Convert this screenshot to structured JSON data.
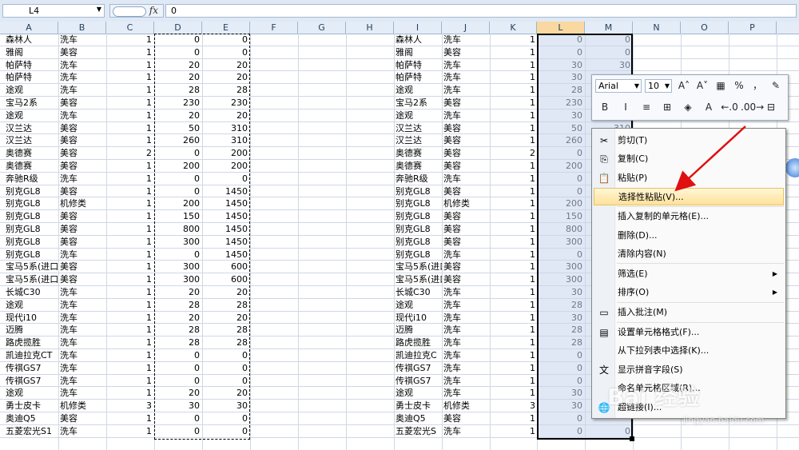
{
  "formula_bar": {
    "name_box": "L4",
    "value": "0"
  },
  "columns": [
    {
      "label": "A",
      "sel": false
    },
    {
      "label": "B",
      "sel": false
    },
    {
      "label": "C",
      "sel": false
    },
    {
      "label": "D",
      "sel": false
    },
    {
      "label": "E",
      "sel": false
    },
    {
      "label": "F",
      "sel": false
    },
    {
      "label": "G",
      "sel": false
    },
    {
      "label": "H",
      "sel": false
    },
    {
      "label": "I",
      "sel": false
    },
    {
      "label": "J",
      "sel": false
    },
    {
      "label": "K",
      "sel": false
    },
    {
      "label": "L",
      "sel": true
    },
    {
      "label": "M",
      "sel": false
    },
    {
      "label": "N",
      "sel": false
    },
    {
      "label": "O",
      "sel": false
    },
    {
      "label": "P",
      "sel": false
    }
  ],
  "left_rows": [
    [
      "森林人",
      "洗车",
      "1",
      "0",
      "0"
    ],
    [
      "雅阁",
      "美容",
      "1",
      "0",
      "0"
    ],
    [
      "帕萨特",
      "洗车",
      "1",
      "20",
      "20"
    ],
    [
      "帕萨特",
      "洗车",
      "1",
      "20",
      "20"
    ],
    [
      "途观",
      "洗车",
      "1",
      "28",
      "28"
    ],
    [
      "宝马2系",
      "美容",
      "1",
      "230",
      "230"
    ],
    [
      "途观",
      "洗车",
      "1",
      "20",
      "20"
    ],
    [
      "汉兰达",
      "美容",
      "1",
      "50",
      "310"
    ],
    [
      "汉兰达",
      "美容",
      "1",
      "260",
      "310"
    ],
    [
      "奥德赛",
      "美容",
      "2",
      "0",
      "200"
    ],
    [
      "奥德赛",
      "美容",
      "1",
      "200",
      "200"
    ],
    [
      "奔驰R级",
      "洗车",
      "1",
      "0",
      "0"
    ],
    [
      "别克GL8",
      "美容",
      "1",
      "0",
      "1450"
    ],
    [
      "别克GL8",
      "机修类",
      "1",
      "200",
      "1450"
    ],
    [
      "别克GL8",
      "美容",
      "1",
      "150",
      "1450"
    ],
    [
      "别克GL8",
      "美容",
      "1",
      "800",
      "1450"
    ],
    [
      "别克GL8",
      "美容",
      "1",
      "300",
      "1450"
    ],
    [
      "别克GL8",
      "洗车",
      "1",
      "0",
      "1450"
    ],
    [
      "宝马5系(进口",
      "美容",
      "1",
      "300",
      "600"
    ],
    [
      "宝马5系(进口",
      "美容",
      "1",
      "300",
      "600"
    ],
    [
      "长城C30",
      "洗车",
      "1",
      "20",
      "20"
    ],
    [
      "途观",
      "洗车",
      "1",
      "28",
      "28"
    ],
    [
      "现代i10",
      "洗车",
      "1",
      "20",
      "20"
    ],
    [
      "迈腾",
      "洗车",
      "1",
      "28",
      "28"
    ],
    [
      "路虎揽胜",
      "洗车",
      "1",
      "28",
      "28"
    ],
    [
      "凯迪拉克CT",
      "洗车",
      "1",
      "0",
      "0"
    ],
    [
      "传祺GS7",
      "洗车",
      "1",
      "0",
      "0"
    ],
    [
      "传祺GS7",
      "洗车",
      "1",
      "0",
      "0"
    ],
    [
      "途观",
      "洗车",
      "1",
      "20",
      "20"
    ],
    [
      "勇士皮卡",
      "机修类",
      "3",
      "30",
      "30"
    ],
    [
      "奥迪Q5",
      "美容",
      "1",
      "0",
      "0"
    ],
    [
      "五菱宏光S1",
      "洗车",
      "1",
      "0",
      "0"
    ]
  ],
  "right_rows": [
    [
      "森林人",
      "洗车",
      "1",
      "0",
      "0"
    ],
    [
      "雅阁",
      "美容",
      "1",
      "0",
      "0"
    ],
    [
      "帕萨特",
      "洗车",
      "1",
      "30",
      "30"
    ],
    [
      "帕萨特",
      "洗车",
      "1",
      "30",
      ""
    ],
    [
      "途观",
      "洗车",
      "1",
      "28",
      ""
    ],
    [
      "宝马2系",
      "美容",
      "1",
      "230",
      ""
    ],
    [
      "途观",
      "洗车",
      "1",
      "30",
      ""
    ],
    [
      "汉兰达",
      "美容",
      "1",
      "50",
      "310"
    ],
    [
      "汉兰达",
      "美容",
      "1",
      "260",
      ""
    ],
    [
      "奥德赛",
      "美容",
      "2",
      "0",
      ""
    ],
    [
      "奥德赛",
      "美容",
      "1",
      "200",
      ""
    ],
    [
      "奔驰R级",
      "洗车",
      "1",
      "0",
      ""
    ],
    [
      "别克GL8",
      "美容",
      "1",
      "0",
      ""
    ],
    [
      "别克GL8",
      "机修类",
      "1",
      "200",
      ""
    ],
    [
      "别克GL8",
      "美容",
      "1",
      "150",
      ""
    ],
    [
      "别克GL8",
      "美容",
      "1",
      "800",
      ""
    ],
    [
      "别克GL8",
      "美容",
      "1",
      "300",
      ""
    ],
    [
      "别克GL8",
      "洗车",
      "1",
      "0",
      ""
    ],
    [
      "宝马5系(进口",
      "美容",
      "1",
      "300",
      ""
    ],
    [
      "宝马5系(进口",
      "美容",
      "1",
      "300",
      ""
    ],
    [
      "长城C30",
      "洗车",
      "1",
      "30",
      ""
    ],
    [
      "途观",
      "洗车",
      "1",
      "28",
      ""
    ],
    [
      "现代i10",
      "洗车",
      "1",
      "30",
      ""
    ],
    [
      "迈腾",
      "洗车",
      "1",
      "28",
      ""
    ],
    [
      "路虎揽胜",
      "洗车",
      "1",
      "28",
      ""
    ],
    [
      "凯迪拉克C",
      "洗车",
      "1",
      "0",
      ""
    ],
    [
      "传祺GS7",
      "洗车",
      "1",
      "0",
      ""
    ],
    [
      "传祺GS7",
      "洗车",
      "1",
      "0",
      ""
    ],
    [
      "途观",
      "洗车",
      "1",
      "30",
      ""
    ],
    [
      "勇士皮卡",
      "机修类",
      "3",
      "30",
      ""
    ],
    [
      "奥迪Q5",
      "美容",
      "1",
      "0",
      ""
    ],
    [
      "五菱宏光S",
      "洗车",
      "1",
      "0",
      "0"
    ]
  ],
  "mini_toolbar": {
    "font": "Arial",
    "size": "10",
    "row1": [
      "A˄",
      "A˅",
      "▦",
      "%",
      "，",
      "✎"
    ],
    "row2": [
      "B",
      "I",
      "≡",
      "⊞",
      "◈",
      "A",
      "←.0",
      ".00→",
      "⊟"
    ]
  },
  "context_menu": [
    {
      "icon": "scissors-icon",
      "glyph": "✂",
      "label": "剪切(T)",
      "arrow": "",
      "hl": false,
      "sep_after": false
    },
    {
      "icon": "copy-icon",
      "glyph": "⎘",
      "label": "复制(C)",
      "arrow": "",
      "hl": false,
      "sep_after": false
    },
    {
      "icon": "paste-icon",
      "glyph": "📋",
      "label": "粘贴(P)",
      "arrow": "",
      "hl": false,
      "sep_after": false
    },
    {
      "icon": "",
      "glyph": "",
      "label": "选择性粘贴(V)...",
      "arrow": "",
      "hl": true,
      "sep_after": true
    },
    {
      "icon": "",
      "glyph": "",
      "label": "插入复制的单元格(E)...",
      "arrow": "",
      "hl": false,
      "sep_after": false
    },
    {
      "icon": "",
      "glyph": "",
      "label": "删除(D)...",
      "arrow": "",
      "hl": false,
      "sep_after": false
    },
    {
      "icon": "",
      "glyph": "",
      "label": "清除内容(N)",
      "arrow": "",
      "hl": false,
      "sep_after": true
    },
    {
      "icon": "",
      "glyph": "",
      "label": "筛选(E)",
      "arrow": "▶",
      "hl": false,
      "sep_after": false
    },
    {
      "icon": "",
      "glyph": "",
      "label": "排序(O)",
      "arrow": "▶",
      "hl": false,
      "sep_after": true
    },
    {
      "icon": "comment-icon",
      "glyph": "▭",
      "label": "插入批注(M)",
      "arrow": "",
      "hl": false,
      "sep_after": true
    },
    {
      "icon": "format-cells-icon",
      "glyph": "▤",
      "label": "设置单元格格式(F)...",
      "arrow": "",
      "hl": false,
      "sep_after": false
    },
    {
      "icon": "",
      "glyph": "",
      "label": "从下拉列表中选择(K)...",
      "arrow": "",
      "hl": false,
      "sep_after": false
    },
    {
      "icon": "phonetic-icon",
      "glyph": "文",
      "label": "显示拼音字段(S)",
      "arrow": "",
      "hl": false,
      "sep_after": false
    },
    {
      "icon": "",
      "glyph": "",
      "label": "命名单元格区域(R)...",
      "arrow": "",
      "hl": false,
      "sep_after": false
    },
    {
      "icon": "hyperlink-icon",
      "glyph": "🌐",
      "label": "超链接(I)...",
      "arrow": "",
      "hl": false,
      "sep_after": false
    }
  ],
  "watermark": {
    "brand": "Bai 经验",
    "url": "jingyan.baidu.com"
  }
}
